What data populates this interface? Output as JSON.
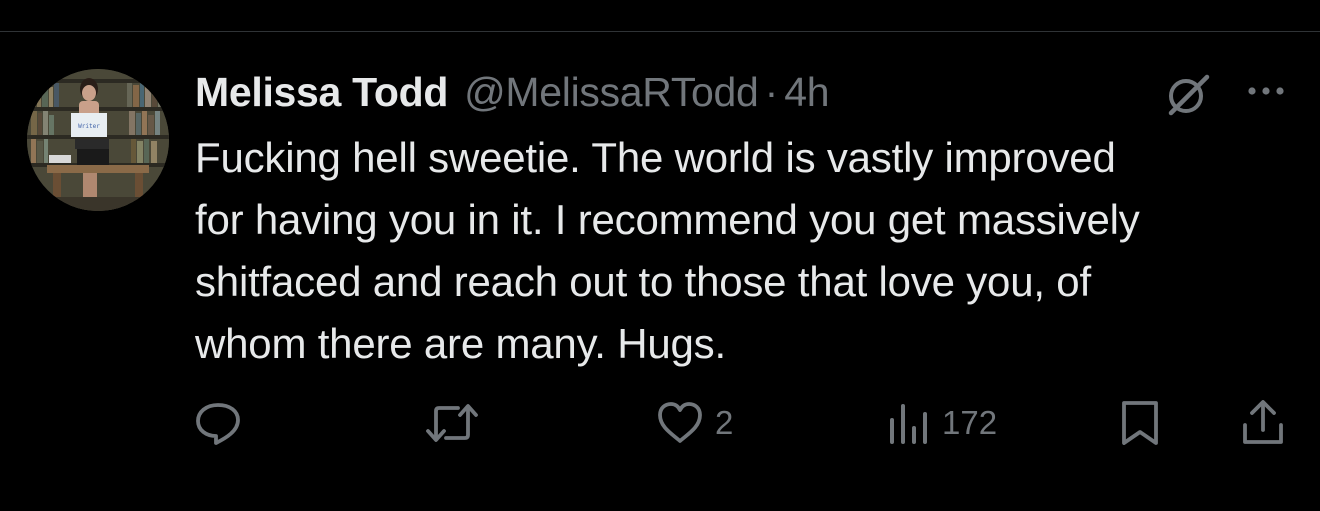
{
  "tweet": {
    "author": {
      "display_name": "Melissa Todd",
      "handle": "@MelissaRTodd",
      "avatar_sign_text": "Writer"
    },
    "separator": "·",
    "time": "4h",
    "text_lines": [
      "Fucking hell sweetie. The world is vastly improved",
      "for having you in it. I recommend you get massively",
      "shitfaced and reach out to those that love you, of",
      "whom there are many. Hugs."
    ],
    "actions": {
      "reply": {
        "icon": "reply-icon",
        "count": ""
      },
      "retweet": {
        "icon": "retweet-icon",
        "count": ""
      },
      "like": {
        "icon": "heart-icon",
        "count": "2"
      },
      "views": {
        "icon": "views-icon",
        "count": "172"
      },
      "bookmark": {
        "icon": "bookmark-icon"
      },
      "share": {
        "icon": "share-icon"
      }
    }
  },
  "colors": {
    "background": "#000000",
    "primary_text": "#e7e9ea",
    "secondary_text": "#71767b",
    "divider": "#2f3336"
  }
}
